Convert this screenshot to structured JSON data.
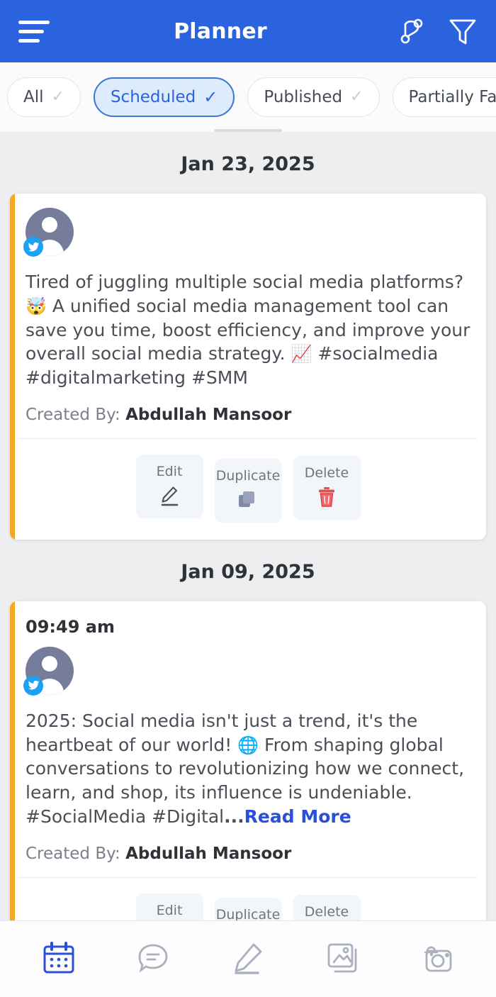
{
  "header": {
    "title": "Planner",
    "menu_icon": "hamburger-menu-icon",
    "branch_icon": "branch-workflow-icon",
    "filter_icon": "filter-funnel-icon"
  },
  "filters": {
    "chips": [
      {
        "label": "All",
        "selected": false,
        "check": "✓"
      },
      {
        "label": "Scheduled",
        "selected": true,
        "check": "✓"
      },
      {
        "label": "Published",
        "selected": false,
        "check": "✓"
      },
      {
        "label": "Partially Failed",
        "selected": false,
        "check": "✓"
      }
    ]
  },
  "groups": [
    {
      "date": "Jan 23, 2025",
      "posts": [
        {
          "time": "",
          "platform": "twitter",
          "avatar_alt": "user-avatar",
          "text_parts": [
            {
              "type": "text",
              "value": "Tired of juggling multiple social media platforms? "
            },
            {
              "type": "emoji",
              "value": "🤯"
            },
            {
              "type": "text",
              "value": " A unified social media management tool can save you time, boost efficiency, and improve your overall social media strategy. "
            },
            {
              "type": "emoji",
              "value": "📈"
            },
            {
              "type": "text",
              "value": " #socialmedia #digitalmarketing #SMM"
            }
          ],
          "truncated": false,
          "read_more": "",
          "created_by_label": "Created By:",
          "created_by_name": "Abdullah Mansoor",
          "actions": [
            {
              "label": "Edit",
              "icon": "pencil-icon"
            },
            {
              "label": "Duplicate",
              "icon": "copy-icon"
            },
            {
              "label": "Delete",
              "icon": "trash-icon"
            }
          ]
        }
      ]
    },
    {
      "date": "Jan 09, 2025",
      "posts": [
        {
          "time": "09:49 am",
          "platform": "twitter",
          "avatar_alt": "user-avatar",
          "text_parts": [
            {
              "type": "text",
              "value": "2025: Social media isn't just a trend, it's the heartbeat of our world! "
            },
            {
              "type": "emoji",
              "value": "🌐"
            },
            {
              "type": "text",
              "value": " From shaping global conversations to revolutionizing how we connect, learn, and shop, its influence is undeniable. #SocialMedia #Digital"
            }
          ],
          "truncated": true,
          "ellipsis": "...",
          "read_more": "Read More",
          "created_by_label": "Created By:",
          "created_by_name": "Abdullah Mansoor",
          "actions": [
            {
              "label": "Edit",
              "icon": "pencil-icon"
            },
            {
              "label": "Duplicate",
              "icon": "copy-icon"
            },
            {
              "label": "Delete",
              "icon": "trash-icon"
            }
          ]
        }
      ]
    }
  ],
  "bottom_nav": {
    "items": [
      {
        "icon": "calendar-icon",
        "active": true
      },
      {
        "icon": "chat-bubble-icon",
        "active": false
      },
      {
        "icon": "compose-pencil-icon",
        "active": false
      },
      {
        "icon": "media-gallery-icon",
        "active": false
      },
      {
        "icon": "camera-notification-icon",
        "active": false
      }
    ]
  },
  "colors": {
    "header_blue": "#2b62dd",
    "accent_orange": "#f5a623",
    "selected_chip_bg": "#ddecfd",
    "twitter_blue": "#1da1f2",
    "delete_red": "#e74c4c",
    "page_bg": "#eceef0"
  }
}
